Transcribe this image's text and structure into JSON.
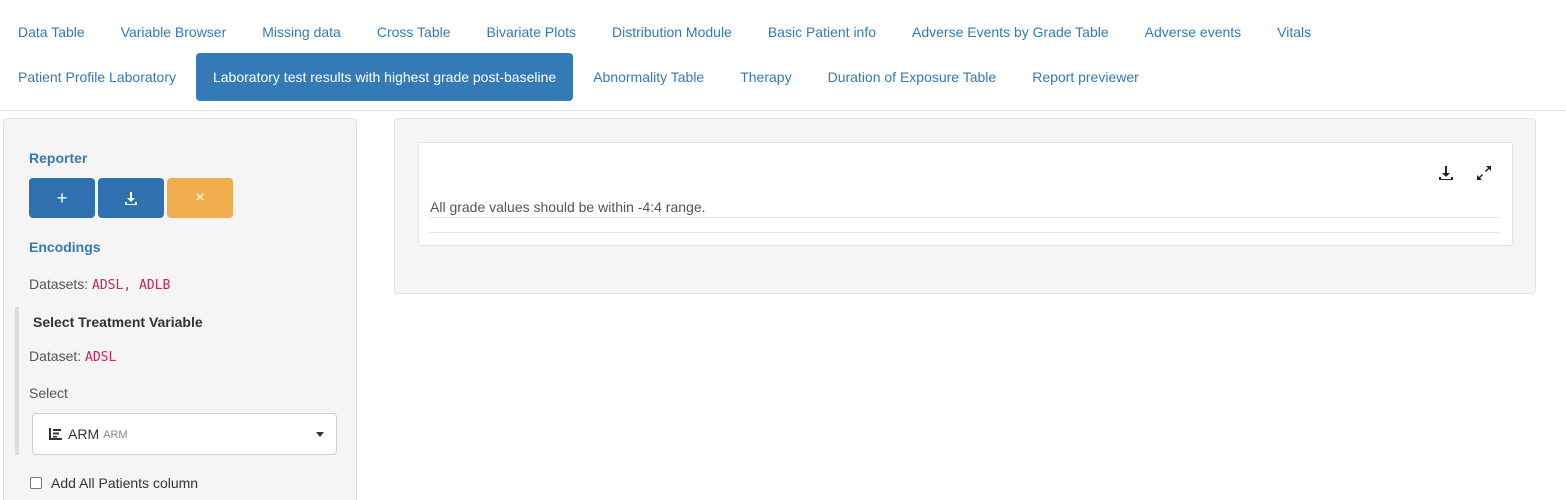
{
  "nav": {
    "row1": [
      "Data Table",
      "Variable Browser",
      "Missing data",
      "Cross Table",
      "Bivariate Plots",
      "Distribution Module",
      "Basic Patient info",
      "Adverse Events by Grade Table",
      "Adverse events",
      "Vitals"
    ],
    "row2": [
      "Patient Profile Laboratory",
      "Laboratory test results with highest grade post-baseline",
      "Abnormality Table",
      "Therapy",
      "Duration of Exposure Table",
      "Report previewer"
    ],
    "active": "Laboratory test results with highest grade post-baseline"
  },
  "sidebar": {
    "reporter_title": "Reporter",
    "buttons": {
      "add": "+",
      "download_icon": "download-icon",
      "reset": "×"
    },
    "encodings_title": "Encodings",
    "datasets_label": "Datasets:",
    "datasets_value": "ADSL, ADLB",
    "treatment": {
      "title": "Select Treatment Variable",
      "dataset_label": "Dataset:",
      "dataset_value": "ADSL",
      "select_label": "Select",
      "selected_value": "ARM",
      "selected_sub": "ARM",
      "selected_icon": "factor-icon"
    },
    "add_all_patients_label": "Add All Patients column",
    "add_all_patients_checked": false
  },
  "main": {
    "message": "All grade values should be within -4:4 range.",
    "icons": [
      "download-icon",
      "expand-icon"
    ]
  },
  "colors": {
    "primary": "#337ab7",
    "warning": "#f0ad4e",
    "code": "#c7254e"
  }
}
